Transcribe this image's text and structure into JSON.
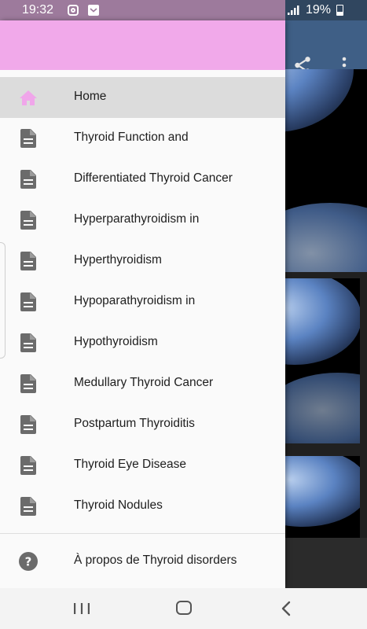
{
  "status_bar": {
    "time": "19:32",
    "battery": "19%",
    "icons": [
      "instagram-icon",
      "mail-icon",
      "signal-icon",
      "battery-icon"
    ]
  },
  "toolbar": {
    "icons": [
      "share-icon",
      "more-vert-icon"
    ]
  },
  "drawer": {
    "header_color": "#f1a9ea",
    "items": [
      {
        "label": "Home",
        "icon": "home-icon",
        "active": true
      },
      {
        "label": "Thyroid Function and",
        "icon": "document-icon"
      },
      {
        "label": "Differentiated Thyroid Cancer",
        "icon": "document-icon"
      },
      {
        "label": "Hyperparathyroidism in",
        "icon": "document-icon"
      },
      {
        "label": "Hyperthyroidism",
        "icon": "document-icon"
      },
      {
        "label": "Hypoparathyroidism in",
        "icon": "document-icon"
      },
      {
        "label": "Hypothyroidism",
        "icon": "document-icon"
      },
      {
        "label": "Medullary Thyroid Cancer",
        "icon": "document-icon"
      },
      {
        "label": "Postpartum Thyroiditis",
        "icon": "document-icon"
      },
      {
        "label": "Thyroid Eye Disease",
        "icon": "document-icon"
      },
      {
        "label": "Thyroid Nodules",
        "icon": "document-icon"
      }
    ],
    "about": {
      "label": "À propos de Thyroid disorders",
      "icon": "help-icon"
    }
  },
  "nav_bar": {
    "icons": [
      "recents-icon",
      "home-nav-icon",
      "back-icon"
    ]
  },
  "colors": {
    "accent_pink": "#f1a9ea",
    "toolbar_blue": "#3f5f86",
    "icon_gray": "#6b6b6b",
    "active_row": "#dcdcdc"
  }
}
